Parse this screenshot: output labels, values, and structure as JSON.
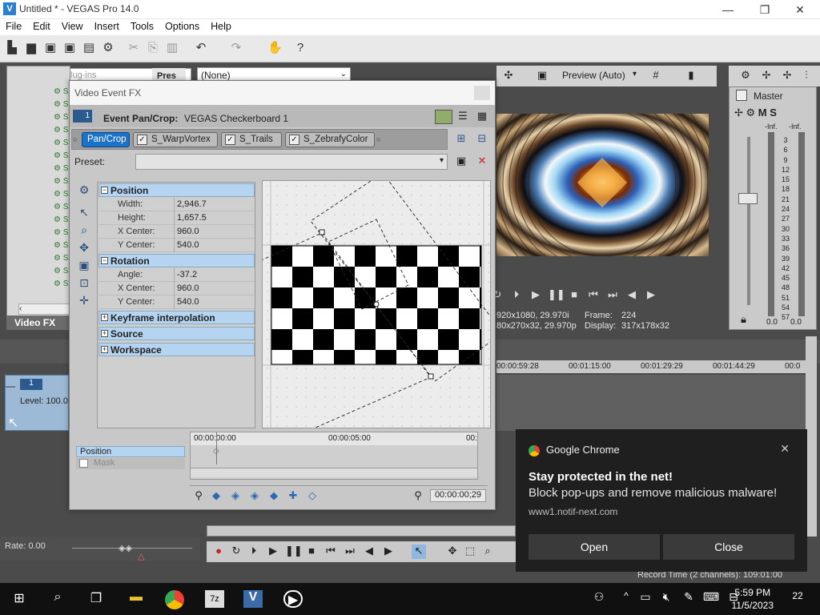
{
  "window": {
    "title": "Untitled * - VEGAS Pro 14.0",
    "app_icon": "V"
  },
  "menu": [
    "File",
    "Edit",
    "View",
    "Insert",
    "Tools",
    "Options",
    "Help"
  ],
  "plugins": {
    "search_placeholder": "Search plug-ins",
    "pres_tab": "Pres",
    "none_option": "(None)",
    "panel_label": "Video FX"
  },
  "dialog": {
    "title": "Video Event FX",
    "event_number": "1",
    "event_label": "Event Pan/Crop:",
    "event_value": "VEGAS Checkerboard 1",
    "chain": [
      "Pan/Crop",
      "S_WarpVortex",
      "S_Trails",
      "S_ZebrafyColor"
    ],
    "preset_label": "Preset:",
    "sections": {
      "position": {
        "title": "Position",
        "rows": [
          {
            "key": "Width:",
            "value": "2,946.7"
          },
          {
            "key": "Height:",
            "value": "1,657.5"
          },
          {
            "key": "X Center:",
            "value": "960.0"
          },
          {
            "key": "Y Center:",
            "value": "540.0"
          }
        ]
      },
      "rotation": {
        "title": "Rotation",
        "rows": [
          {
            "key": "Angle:",
            "value": "-37.2"
          },
          {
            "key": "X Center:",
            "value": "960.0"
          },
          {
            "key": "Y Center:",
            "value": "540.0"
          }
        ]
      },
      "keyframe": "Keyframe interpolation",
      "source": "Source",
      "workspace": "Workspace"
    },
    "kf_tracks": [
      "Position",
      "Mask"
    ],
    "kf_times": [
      "00:00:00:00",
      "00:00:05:00",
      "00:"
    ],
    "kf_time_display": "00:00:00;29"
  },
  "preview": {
    "mode": "Preview (Auto)",
    "info_line1_left": "920x1080, 29.970i",
    "info_line1_right_label": "Frame:",
    "info_line1_right_value": "224",
    "info_line2_left": "80x270x32, 29.970p",
    "info_line2_right_label": "Display:",
    "info_line2_right_value": "317x178x32"
  },
  "master": {
    "title": "Master",
    "scale": [
      "3",
      "6",
      "9",
      "12",
      "15",
      "18",
      "21",
      "24",
      "27",
      "30",
      "33",
      "36",
      "39",
      "42",
      "45",
      "48",
      "51",
      "54",
      "57"
    ],
    "inf_left": "-Inf.",
    "inf_right": "-Inf.",
    "bottom_left": "0.0",
    "bottom_right": "0.0"
  },
  "timeline": {
    "ruler": [
      "00:00:59:28",
      "00:01:15:00",
      "00:01:29:29",
      "00:01:44:29",
      "00:0"
    ],
    "track_number": "1",
    "track_level": "Level: 100.0",
    "rate": "Rate: 0.00",
    "record_time": "Record Time (2 channels): 109:01:00"
  },
  "toast": {
    "app": "Google Chrome",
    "title": "Stay protected in the net!",
    "body": "Block pop-ups and remove malicious malware!",
    "url": "www1.notif-next.com",
    "open": "Open",
    "close": "Close"
  },
  "taskbar": {
    "time": "5:59 PM",
    "date": "11/5/2023",
    "notifications": "22"
  },
  "colors": {
    "accent": "#1a73c8",
    "section_bg": "#b5d4f1",
    "toast_bg": "#1f1f1f"
  }
}
